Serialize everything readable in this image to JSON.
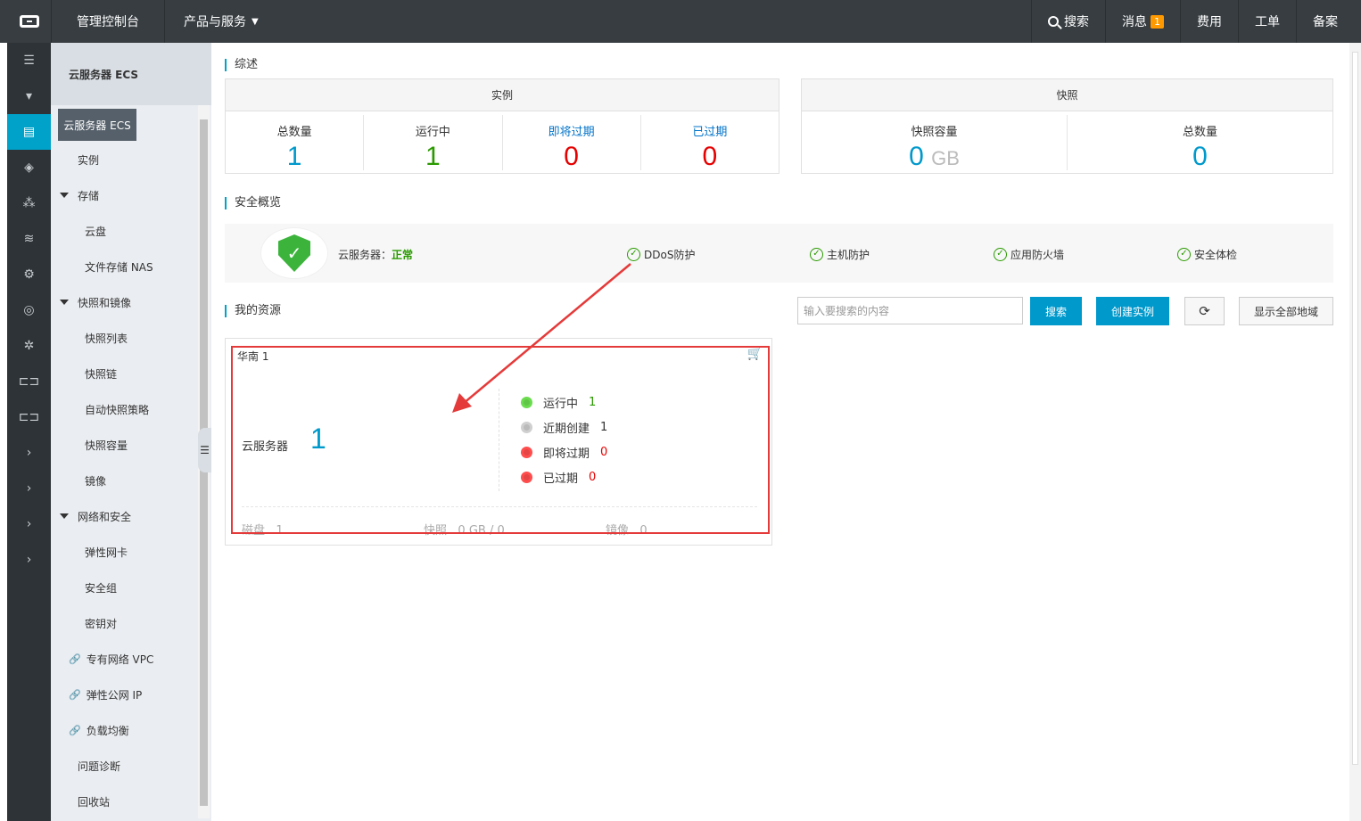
{
  "topbar": {
    "console": "管理控制台",
    "products": "产品与服务",
    "search": "搜索",
    "messages": "消息",
    "messages_count": "1",
    "billing": "费用",
    "tickets": "工单",
    "icp": "备案"
  },
  "sidebar": {
    "title": "云服务器 ECS",
    "selected": "云服务器 ECS",
    "items": [
      {
        "label": "实例",
        "level": 1
      },
      {
        "label": "存储",
        "level": 1,
        "group": true
      },
      {
        "label": "云盘",
        "level": 2
      },
      {
        "label": "文件存储 NAS",
        "level": 2
      },
      {
        "label": "快照和镜像",
        "level": 1,
        "group": true
      },
      {
        "label": "快照列表",
        "level": 2
      },
      {
        "label": "快照链",
        "level": 2
      },
      {
        "label": "自动快照策略",
        "level": 2
      },
      {
        "label": "快照容量",
        "level": 2
      },
      {
        "label": "镜像",
        "level": 2
      },
      {
        "label": "网络和安全",
        "level": 1,
        "group": true
      },
      {
        "label": "弹性网卡",
        "level": 2
      },
      {
        "label": "安全组",
        "level": 2
      },
      {
        "label": "密钥对",
        "level": 2
      },
      {
        "label": "专有网络 VPC",
        "level": 2,
        "link": true
      },
      {
        "label": "弹性公网 IP",
        "level": 2,
        "link": true
      },
      {
        "label": "负载均衡",
        "level": 2,
        "link": true
      },
      {
        "label": "问题诊断",
        "level": 1
      },
      {
        "label": "回收站",
        "level": 1
      }
    ]
  },
  "overview": {
    "title": "综述",
    "instances": {
      "header": "实例",
      "total_label": "总数量",
      "total": "1",
      "running_label": "运行中",
      "running": "1",
      "expiring_label": "即将过期",
      "expiring": "0",
      "expired_label": "已过期",
      "expired": "0"
    },
    "snapshots": {
      "header": "快照",
      "capacity_label": "快照容量",
      "capacity": "0",
      "capacity_unit": "GB",
      "total_label": "总数量",
      "total": "0"
    }
  },
  "security": {
    "title": "安全概览",
    "status_label": "云服务器：",
    "status": "正常",
    "items": [
      "DDoS防护",
      "主机防护",
      "应用防火墙",
      "安全体检"
    ]
  },
  "resources": {
    "title": "我的资源",
    "search_placeholder": "输入要搜索的内容",
    "search_button": "搜索",
    "create_button": "创建实例",
    "show_all_button": "显示全部地域",
    "region": "华南 1",
    "ecs_label": "云服务器",
    "ecs_count": "1",
    "statuses": [
      {
        "label": "运行中",
        "value": "1",
        "color": "#2a9a00"
      },
      {
        "label": "近期创建",
        "value": "1",
        "color": "#333333"
      },
      {
        "label": "即将过期",
        "value": "0",
        "color": "#e60000"
      },
      {
        "label": "已过期",
        "value": "0",
        "color": "#e60000"
      }
    ],
    "disk_label": "磁盘",
    "disk_value": "1",
    "snapshot_label": "快照",
    "snapshot_value": "0 GB / 0",
    "image_label": "镜像",
    "image_value": "0"
  },
  "colors": {
    "accent": "#00a2ca",
    "annotation": "#e53a3a"
  }
}
